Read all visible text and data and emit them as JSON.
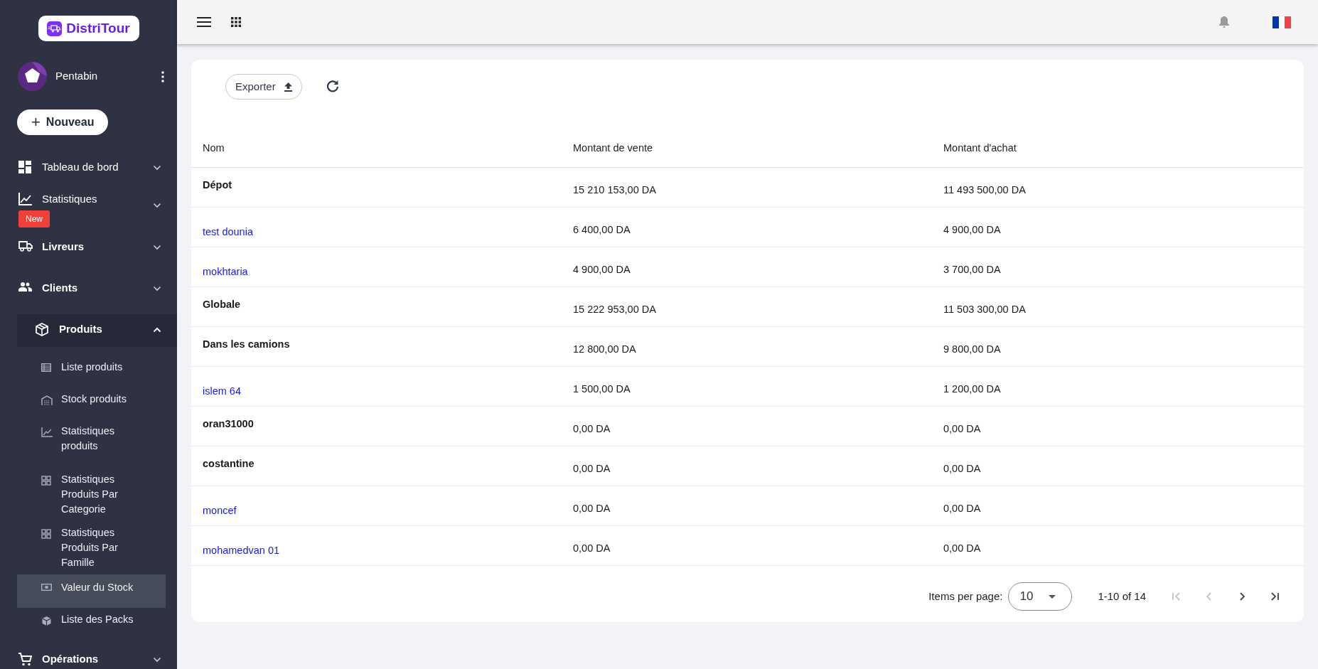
{
  "brand": "DistriTour",
  "user": {
    "name": "Pentabin"
  },
  "new_button": {
    "label": "Nouveau",
    "icon": "+"
  },
  "nav": [
    {
      "label": "Tableau de bord",
      "expanded": false,
      "bold": false
    },
    {
      "label": "Statistiques",
      "expanded": false,
      "bold": false,
      "badge": "New"
    },
    {
      "label": "Livreurs",
      "expanded": false,
      "bold": true
    },
    {
      "label": "Clients",
      "expanded": false,
      "bold": true
    },
    {
      "label": "Produits",
      "expanded": true,
      "bold": true,
      "children": [
        {
          "label": "Liste produits",
          "selected": false
        },
        {
          "label": "Stock produits",
          "selected": false
        },
        {
          "label": "Statistiques produits",
          "selected": false
        },
        {
          "label": "Statistiques Produits Par Categorie",
          "selected": false
        },
        {
          "label": "Statistiques Produits Par Famille",
          "selected": false
        },
        {
          "label": "Valeur du Stock",
          "selected": true
        },
        {
          "label": "Liste des Packs",
          "selected": false
        }
      ]
    },
    {
      "label": "Opérations",
      "expanded": false,
      "bold": true
    }
  ],
  "toolbar": {
    "export_label": "Exporter"
  },
  "table": {
    "columns": [
      "Nom",
      "Montant de vente",
      "Montant d'achat"
    ],
    "rows": [
      {
        "kind": "group",
        "name": "Dépot",
        "sale": "15 210 153,00 DA",
        "purchase": "11 493 500,00 DA"
      },
      {
        "kind": "link",
        "name": "test dounia",
        "sale": "6 400,00 DA",
        "purchase": "4 900,00 DA"
      },
      {
        "kind": "link",
        "name": "mokhtaria",
        "sale": "4 900,00 DA",
        "purchase": "3 700,00 DA"
      },
      {
        "kind": "group",
        "name": "Globale",
        "sale": "15 222 953,00 DA",
        "purchase": "11 503 300,00 DA"
      },
      {
        "kind": "group",
        "name": "Dans les camions",
        "sale": "12 800,00 DA",
        "purchase": "9 800,00 DA"
      },
      {
        "kind": "link",
        "name": "islem 64",
        "sale": "1 500,00 DA",
        "purchase": "1 200,00 DA"
      },
      {
        "kind": "group",
        "name": "oran31000",
        "sale": "0,00 DA",
        "purchase": "0,00 DA"
      },
      {
        "kind": "group",
        "name": "costantine",
        "sale": "0,00 DA",
        "purchase": "0,00 DA"
      },
      {
        "kind": "link",
        "name": "moncef",
        "sale": "0,00 DA",
        "purchase": "0,00 DA"
      },
      {
        "kind": "link",
        "name": "mohamedvan 01",
        "sale": "0,00 DA",
        "purchase": "0,00 DA"
      }
    ]
  },
  "paginator": {
    "label": "Items per page:",
    "page_size": "10",
    "range": "1-10 of 14",
    "buttons": [
      {
        "kind": "first",
        "disabled": true
      },
      {
        "kind": "prev",
        "disabled": true
      },
      {
        "kind": "next",
        "disabled": false
      },
      {
        "kind": "last",
        "disabled": false
      }
    ]
  }
}
